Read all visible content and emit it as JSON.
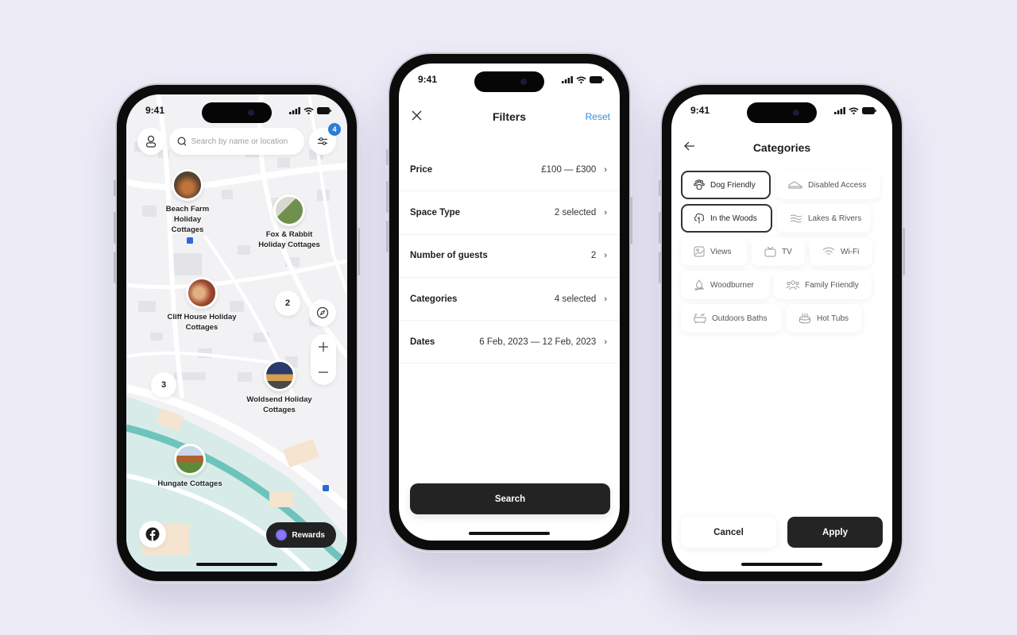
{
  "colors": {
    "background": "#ecebf6",
    "accent_blue": "#3a8fd6",
    "badge_blue": "#2a7fd4",
    "dark_button": "#232323",
    "water": "#6ec4bc"
  },
  "status_bar": {
    "time": "9:41"
  },
  "map_screen": {
    "search": {
      "placeholder": "Search by name or location"
    },
    "filter_badge": "4",
    "pins": [
      {
        "name": "Beach Farm\nHoliday Cottages",
        "photo_color": "#7a5a3a"
      },
      {
        "name": "Fox & Rabbit\nHoliday Cottages",
        "photo_color": "#7b8a5a"
      },
      {
        "name": "Cliff House Holiday\nCottages",
        "photo_color": "#a2503a"
      },
      {
        "name": "Woldsend Holiday\nCottages",
        "photo_color": "#3e4e72"
      },
      {
        "name": "Hungate Cottages",
        "photo_color": "#8a6a4a"
      }
    ],
    "clusters": [
      "2",
      "3"
    ],
    "rewards_label": "Rewards",
    "icons": {
      "profile": "user-icon",
      "search": "search-icon",
      "filter": "sliders-icon",
      "compass": "compass-icon",
      "zoom_in": "plus-icon",
      "zoom_out": "minus-icon",
      "social": "facebook-icon",
      "rewards": "rewards-badge-icon"
    }
  },
  "filters_screen": {
    "title": "Filters",
    "reset_label": "Reset",
    "rows": [
      {
        "label": "Price",
        "value": "£100 — £300"
      },
      {
        "label": "Space Type",
        "value": "2 selected"
      },
      {
        "label": "Number of guests",
        "value": "2"
      },
      {
        "label": "Categories",
        "value": "4 selected"
      },
      {
        "label": "Dates",
        "value": "6 Feb, 2023 — 12 Feb, 2023"
      }
    ],
    "search_label": "Search"
  },
  "categories_screen": {
    "title": "Categories",
    "chips": [
      {
        "label": "Dog Friendly",
        "icon": "paw-icon",
        "selected": true
      },
      {
        "label": "Disabled Access",
        "icon": "ramp-icon",
        "selected": false
      },
      {
        "label": "In the Woods",
        "icon": "tree-icon",
        "selected": true
      },
      {
        "label": "Lakes & Rivers",
        "icon": "waves-icon",
        "selected": false
      },
      {
        "label": "Views",
        "icon": "image-icon",
        "selected": false
      },
      {
        "label": "TV",
        "icon": "tv-icon",
        "selected": false
      },
      {
        "label": "Wi-Fi",
        "icon": "wifi-icon",
        "selected": false
      },
      {
        "label": "Woodburner",
        "icon": "fire-icon",
        "selected": false
      },
      {
        "label": "Family Friendly",
        "icon": "family-icon",
        "selected": false
      },
      {
        "label": "Outdoors Baths",
        "icon": "bath-icon",
        "selected": false
      },
      {
        "label": "Hot Tubs",
        "icon": "hot-tub-icon",
        "selected": false
      }
    ],
    "cancel_label": "Cancel",
    "apply_label": "Apply"
  }
}
